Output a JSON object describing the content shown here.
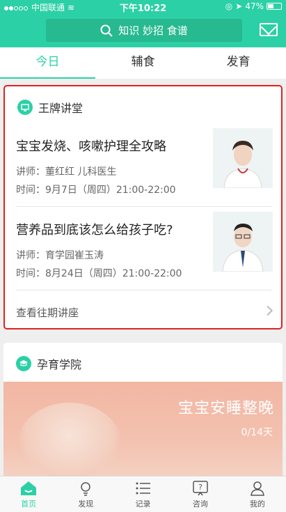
{
  "status_bar": {
    "carrier": "中国联通",
    "time": "下午10:22",
    "battery": "47%",
    "signal_dots_filled": 2,
    "signal_dots_total": 5,
    "battery_level": 0.47
  },
  "header": {
    "search_placeholder": "知识 妙招 食谱",
    "mail_icon": "mail-icon",
    "accent_color": "#2cd0a6"
  },
  "tabs": [
    {
      "label": "今日",
      "active": true
    },
    {
      "label": "辅食",
      "active": false
    },
    {
      "label": "发育",
      "active": false
    }
  ],
  "lecture_section": {
    "title": "王牌讲堂",
    "items": [
      {
        "title": "宝宝发烧、咳嗽护理全攻略",
        "lecturer": "讲师：董红红 儿科医生",
        "time": "时间：9月7日（周四）21:00-22:00"
      },
      {
        "title": "营养品到底该怎么给孩子吃?",
        "lecturer": "讲师：育学园崔玉涛",
        "time": "时间：8月24日（周四）21:00-22:00"
      }
    ],
    "more_label": "查看往期讲座"
  },
  "academy_section": {
    "title": "孕育学院",
    "banner_title": "宝宝安睡整晚",
    "banner_progress": "0/14天"
  },
  "bottom_nav": [
    {
      "label": "首页",
      "icon": "home-icon",
      "active": true
    },
    {
      "label": "发现",
      "icon": "lightbulb-icon",
      "active": false
    },
    {
      "label": "记录",
      "icon": "list-icon",
      "active": false
    },
    {
      "label": "咨询",
      "icon": "question-icon",
      "active": false
    },
    {
      "label": "我的",
      "icon": "user-icon",
      "active": false
    }
  ]
}
